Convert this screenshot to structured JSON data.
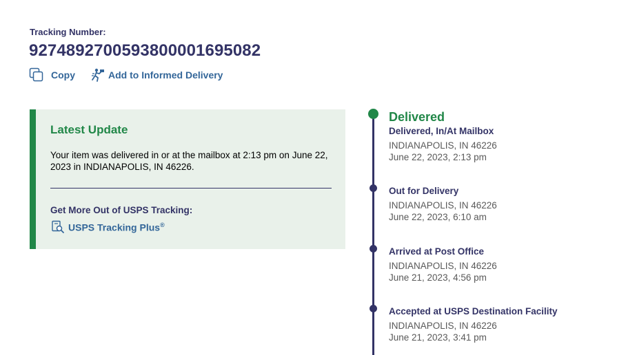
{
  "header": {
    "tracking_label": "Tracking Number:",
    "tracking_number": "9274892700593800001695082",
    "copy_label": "Copy",
    "informed_label": "Add to Informed Delivery"
  },
  "latest_update": {
    "title": "Latest Update",
    "text": "Your item was delivered in or at the mailbox at 2:13 pm on June 22, 2023 in INDIANAPOLIS, IN 46226.",
    "more_title": "Get More Out of USPS Tracking:",
    "plus_link": "USPS Tracking Plus",
    "plus_sup": "®"
  },
  "timeline": {
    "current_status": "Delivered",
    "events": [
      {
        "status": "Delivered, In/At Mailbox",
        "location": "INDIANAPOLIS, IN 46226",
        "datetime": "June 22, 2023, 2:13 pm"
      },
      {
        "status": "Out for Delivery",
        "location": "INDIANAPOLIS, IN 46226",
        "datetime": "June 22, 2023, 6:10 am"
      },
      {
        "status": "Arrived at Post Office",
        "location": "INDIANAPOLIS, IN 46226",
        "datetime": "June 21, 2023, 4:56 pm"
      },
      {
        "status": "Accepted at USPS Destination Facility",
        "location": "INDIANAPOLIS, IN 46226",
        "datetime": "June 21, 2023, 3:41 pm"
      }
    ]
  },
  "colors": {
    "navy": "#333366",
    "green": "#218748",
    "link": "#336699",
    "panel": "#e9f1ea"
  },
  "icons": [
    "copy-icon",
    "informed-delivery-icon",
    "tracking-plus-icon"
  ]
}
